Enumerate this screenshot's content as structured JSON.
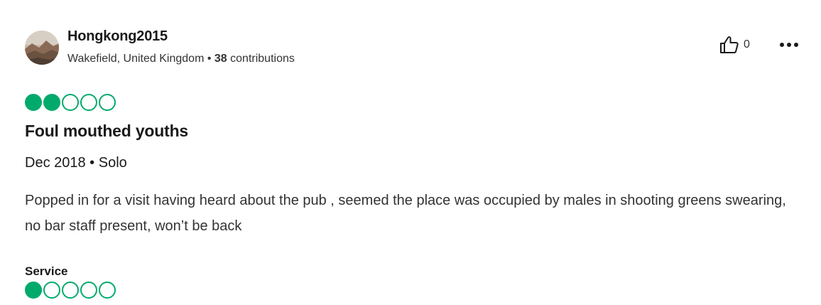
{
  "reviewer": {
    "name": "Hongkong2015",
    "location": "Wakefield, United Kingdom",
    "separator": "•",
    "contributions_count": "38",
    "contributions_label": "contributions"
  },
  "actions": {
    "like_icon": "thumbs-up-icon",
    "like_count": "0",
    "more_icon": "more-options-icon"
  },
  "review": {
    "rating": 2,
    "rating_max": 5,
    "title": "Foul mouthed youths",
    "visit": "Dec 2018 • Solo",
    "text": "Popped in for a visit having heard about the pub , seemed the place was occupied by males in shooting greens swearing, no bar staff present, won’t be back"
  },
  "subratings": [
    {
      "label": "Service",
      "rating": 1,
      "rating_max": 5
    }
  ],
  "colors": {
    "bubble_green": "#00aa6c",
    "text_dark": "#1a1a1a"
  }
}
